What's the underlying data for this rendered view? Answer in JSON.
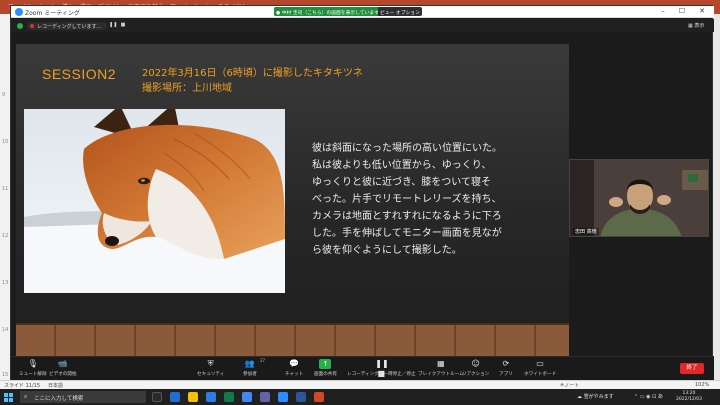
{
  "ppt": {
    "tabs": "ファイル　ホーム　挿入　描画　デザイン　画面切り替え　アニメーション　スライドショー",
    "ruler_numbers": [
      "9",
      "10",
      "11",
      "12",
      "13",
      "14",
      "15"
    ],
    "status_slide": "スライド 11/15",
    "status_lang": "日本語",
    "status_notes": "≙ノート",
    "status_zoom": "102%"
  },
  "zoom": {
    "window_title": "Zoom ミーティング",
    "banner_text": "● 中村 圭司（こちら）の画面を表示しています",
    "banner_option": "ビュー オプション ∨",
    "recording_text": "レコーディングしています...",
    "view_label": "表示",
    "slide": {
      "session": "SESSION2",
      "heading_line1": "2022年3月16日（6時頃）に撮影したキタキツネ",
      "heading_line2": "撮影場所：上川地域",
      "body_lines": [
        "彼は斜面になった場所の高い位置にいた。",
        "私は彼よりも低い位置から、ゆっくり、",
        "ゆっくりと彼に近づき、膝をついて寝そ",
        "べった。片手でリモートレリーズを持ち、",
        "カメラは地面とすれすれになるように下ろ",
        "した。手を伸ばしてモニター画面を見なが",
        "ら彼を仰ぐようにして撮影した。"
      ]
    },
    "participant_name": "忠田 高徳",
    "toolbar": {
      "mute": "ミュート解除",
      "video": "ビデオの開始",
      "security": "セキュリティ",
      "participants": "参加者",
      "participants_count": "27",
      "chat": "チャット",
      "share": "画面の共有",
      "record": "レコーディングを一時停止／停止",
      "breakout": "ブレイクアウトルーム",
      "reactions": "リアクション",
      "apps": "アプリ",
      "whiteboard": "ホワイトボード",
      "end": "終了"
    }
  },
  "taskbar": {
    "search_placeholder": "ここに入力して検索",
    "weather": "雪がやみます",
    "time": "13:20",
    "date": "2022/12/03"
  },
  "colors": {
    "accent_orange": "#f0a020",
    "end_red": "#e02828",
    "share_green": "#26b04a"
  }
}
